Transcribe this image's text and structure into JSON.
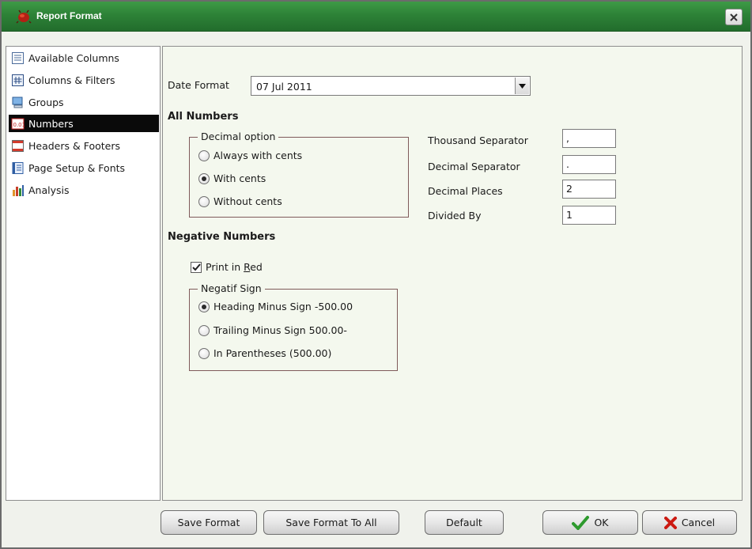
{
  "window": {
    "title": "Report Format"
  },
  "sidebar": {
    "items": [
      {
        "label": "Available Columns",
        "icon": "columns-list-icon"
      },
      {
        "label": "Columns & Filters",
        "icon": "filter-icon"
      },
      {
        "label": "Groups",
        "icon": "groups-icon"
      },
      {
        "label": "Numbers",
        "icon": "numbers-icon",
        "active": true
      },
      {
        "label": "Headers & Footers",
        "icon": "headers-footers-icon"
      },
      {
        "label": "Page Setup & Fonts",
        "icon": "page-setup-icon"
      },
      {
        "label": "Analysis",
        "icon": "analysis-chart-icon"
      }
    ]
  },
  "date_format": {
    "label": "Date Format",
    "value": "07 Jul 2011"
  },
  "all_numbers": {
    "title": "All Numbers",
    "decimal_option": {
      "legend": "Decimal option",
      "options": [
        "Always with cents",
        "With cents",
        "Without cents"
      ],
      "selected": "With cents"
    },
    "fields": {
      "thousand_separator": {
        "label": "Thousand Separator",
        "value": ","
      },
      "decimal_separator": {
        "label": "Decimal Separator",
        "value": "."
      },
      "decimal_places": {
        "label": "Decimal Places",
        "value": "2"
      },
      "divided_by": {
        "label": "Divided By",
        "value": "1"
      }
    }
  },
  "negative_numbers": {
    "title": "Negative Numbers",
    "print_in_red": {
      "label_pre": "Print in ",
      "label_underlined": "R",
      "label_post": "ed",
      "checked": true
    },
    "negatif_sign": {
      "legend": "Negatif Sign",
      "options": [
        "Heading Minus Sign -500.00",
        "Trailing Minus Sign 500.00-",
        "In Parentheses (500.00)"
      ],
      "selected": "Heading Minus Sign -500.00"
    }
  },
  "buttons": {
    "save_format": "Save Format",
    "save_format_to_all": "Save Format To All",
    "default": "Default",
    "ok": "OK",
    "cancel": "Cancel"
  },
  "colors": {
    "titlebar": "#2d8237",
    "ok_check": "#2e9a2e",
    "cancel_x": "#cc1a12"
  }
}
